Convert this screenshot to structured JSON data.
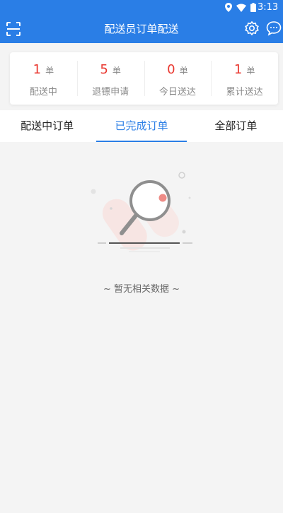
{
  "status_bar": {
    "time": "3:13"
  },
  "header": {
    "title": "配送员订单配送"
  },
  "stats": [
    {
      "value": "1",
      "unit": "单",
      "label": "配送中"
    },
    {
      "value": "5",
      "unit": "单",
      "label": "退镖申请"
    },
    {
      "value": "0",
      "unit": "单",
      "label": "今日送达"
    },
    {
      "value": "1",
      "unit": "单",
      "label": "累计送达"
    }
  ],
  "tabs": [
    {
      "label": "配送中订单",
      "active": false
    },
    {
      "label": "已完成订单",
      "active": true
    },
    {
      "label": "全部订单",
      "active": false
    }
  ],
  "empty_state": {
    "text": "~ 暂无相关数据 ~"
  },
  "colors": {
    "primary": "#2a7ee6",
    "accent_red": "#e9372f",
    "background": "#f4f4f4"
  }
}
